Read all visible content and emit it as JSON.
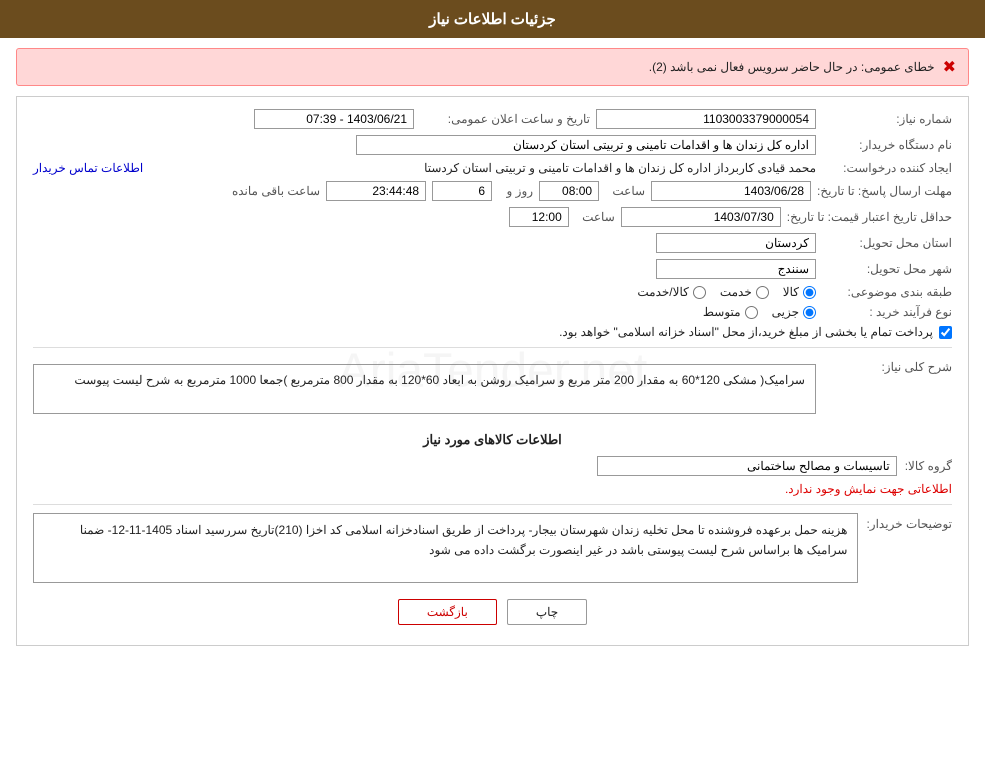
{
  "header": {
    "title": "جزئیات اطلاعات نیاز"
  },
  "error": {
    "icon": "✖",
    "text": "خطای عمومی: در حال حاضر سرویس فعال نمی باشد (2)."
  },
  "form": {
    "need_number_label": "شماره نیاز:",
    "need_number_value": "1103003379000054",
    "buyer_org_label": "نام دستگاه خریدار:",
    "buyer_org_value": "اداره کل زندان ها و اقدامات تامینی و تربیتی استان کردستان",
    "requester_label": "ایجاد کننده درخواست:",
    "requester_value": "محمد  قیادی کاربرداز اداره کل زندان ها و اقدامات تامینی و تربیتی استان کردستا",
    "requester_link": "اطلاعات تماس خریدار",
    "announce_datetime_label": "تاریخ و ساعت اعلان عمومی:",
    "announce_date": "1403/06/21 - 07:39",
    "reply_deadline_label": "مهلت ارسال پاسخ: تا تاریخ:",
    "reply_date": "1403/06/28",
    "reply_time": "08:00",
    "reply_days": "6",
    "reply_remaining_time": "23:44:48",
    "reply_remaining_label": "ساعت باقی مانده",
    "reply_remaining_unit": "روز و",
    "price_validity_label": "حداقل تاریخ اعتبار قیمت: تا تاریخ:",
    "price_validity_date": "1403/07/30",
    "price_validity_time": "12:00",
    "delivery_province_label": "استان محل تحویل:",
    "delivery_province": "کردستان",
    "delivery_city_label": "شهر محل تحویل:",
    "delivery_city": "سنندج",
    "category_label": "طبقه بندی موضوعی:",
    "category_options": [
      "کالا",
      "خدمت",
      "کالا/خدمت"
    ],
    "category_selected": "کالا",
    "purchase_type_label": "نوع فرآیند خرید :",
    "purchase_type_options": [
      "جزیی",
      "متوسط"
    ],
    "purchase_type_selected": "جزیی",
    "payment_checkbox_label": "پرداخت تمام یا بخشی از مبلغ خرید،از محل \"اسناد خزانه اسلامی\" خواهد بود.",
    "payment_checked": true,
    "need_description_label": "شرح کلی نیاز:",
    "need_description": "سرامیک( مشکی  120*60  به مقدار 200 متر مربع  و  سرامیک روشن به ابعاد 60*120 به مقدار 800 مترمربع )جمعا 1000 مترمربع به شرح لیست پیوست",
    "goods_section_title": "اطلاعات کالاهای مورد نیاز",
    "goods_group_label": "گروه کالا:",
    "goods_group_value": "تاسیسات و مصالح ساختمانی",
    "no_info_notice": "اطلاعاتی جهت نمایش وجود ندارد.",
    "buyer_notes_label": "توضیحات خریدار:",
    "buyer_notes_value": "هزینه حمل برعهده فروشنده  تا محل  تخلیه  زندان  شهرستان بیجار- پرداخت از طریق اسنادخزانه اسلامی کد اخزا (210)تاریخ سررسید اسناد 1405-11-12- ضمنا سرامیک ها براساس شرح لیست پیوستی باشد در غیر اینصورت برگشت  داده می شود"
  },
  "buttons": {
    "print_label": "چاپ",
    "back_label": "بازگشت"
  }
}
